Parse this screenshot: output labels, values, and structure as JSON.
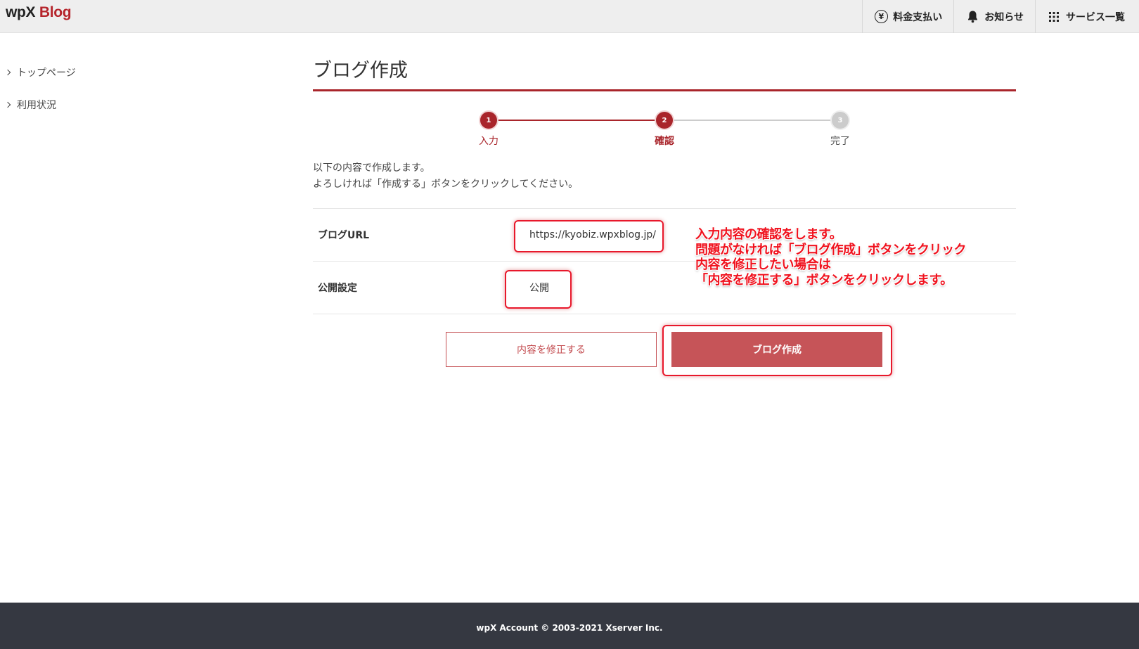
{
  "header": {
    "logo_wpx": "wpX",
    "logo_blog": "Blog",
    "nav": [
      {
        "icon": "yen-icon",
        "label": "料金支払い"
      },
      {
        "icon": "bell-icon",
        "label": "お知らせ"
      },
      {
        "icon": "grid-icon",
        "label": "サービス一覧"
      }
    ]
  },
  "sidebar": {
    "items": [
      {
        "label": "トップページ"
      },
      {
        "label": "利用状況"
      }
    ]
  },
  "main": {
    "title": "ブログ作成",
    "steps": [
      {
        "number": "1",
        "label": "入力",
        "state": "done"
      },
      {
        "number": "2",
        "label": "確認",
        "state": "current"
      },
      {
        "number": "3",
        "label": "完了",
        "state": "pending"
      }
    ],
    "intro_line1": "以下の内容で作成します。",
    "intro_line2": "よろしければ「作成する」ボタンをクリックしてください。",
    "rows": [
      {
        "label": "ブログURL",
        "value": "https://kyobiz.wpxblog.jp/"
      },
      {
        "label": "公開設定",
        "value": "公開"
      }
    ],
    "edit_button": "内容を修正する",
    "create_button": "ブログ作成"
  },
  "annotation": {
    "lines": [
      "入力内容の確認をします。",
      "問題がなければ「ブログ作成」ボタンをクリック",
      "内容を修正したい場合は",
      "「内容を修正する」ボタンをクリックします。"
    ]
  },
  "footer": {
    "copyright": "wpX Account © 2003-2021 Xserver Inc."
  },
  "colors": {
    "brand_red": "#a9252b",
    "button_red": "#c65458",
    "annotation_red": "#e8182b",
    "footer_bg": "#353841"
  }
}
